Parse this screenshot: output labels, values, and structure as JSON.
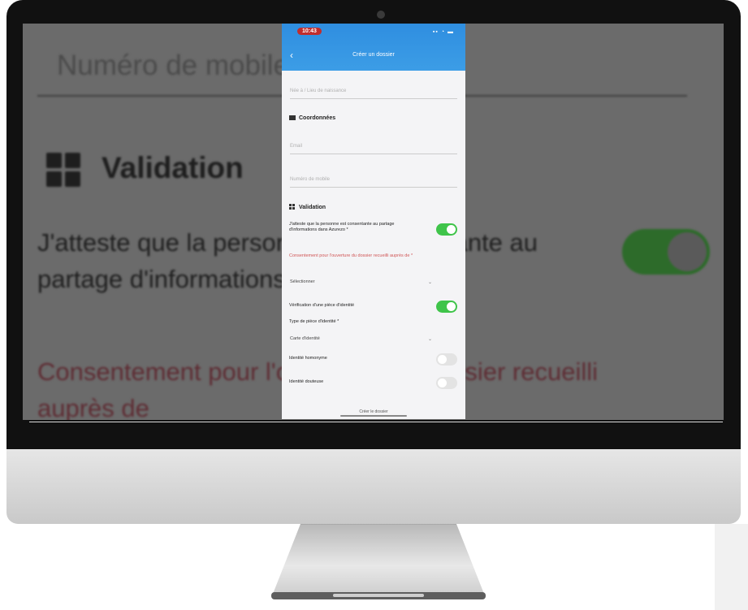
{
  "background_app": {
    "input_placeholder": "Numéro de mobile",
    "section_heading": "Validation",
    "consent_text": "J'atteste que la personne est consentante au partage d'informations dans Azurezo *",
    "consent_note": "Consentement pour l'ouverture du dossier recueilli auprès de"
  },
  "phone": {
    "status_time": "10:43",
    "status_icons": "▪▪ ◔ ▬",
    "header_title": "Créer un dossier",
    "field_placeholder": "Née à / Lieu de naissance",
    "coordinates_heading": "Coordonnées",
    "email_placeholder": "Email",
    "mobile_placeholder": "Numéro de mobile",
    "validation_heading": "Validation",
    "consent_text": "J'atteste que la personne est consentante au partage d'informations dans Azurezo *",
    "consent_note": "Consentement pour l'ouverture du dossier recueilli auprès de *",
    "consent_select": "Sélectionner",
    "id_check_label": "Vérification d'une pièce d'identité",
    "id_type_label": "Type de pièce d'identité *",
    "id_type_value": "Carte d'identité",
    "homonym_label": "Identité homonyme",
    "doubtful_label": "Identité douteuse",
    "bottom_button": "Créer le dossier"
  },
  "colors": {
    "header_blue": "#3c9de6",
    "toggle_on": "#3fc44a",
    "note_red": "#d05555"
  }
}
